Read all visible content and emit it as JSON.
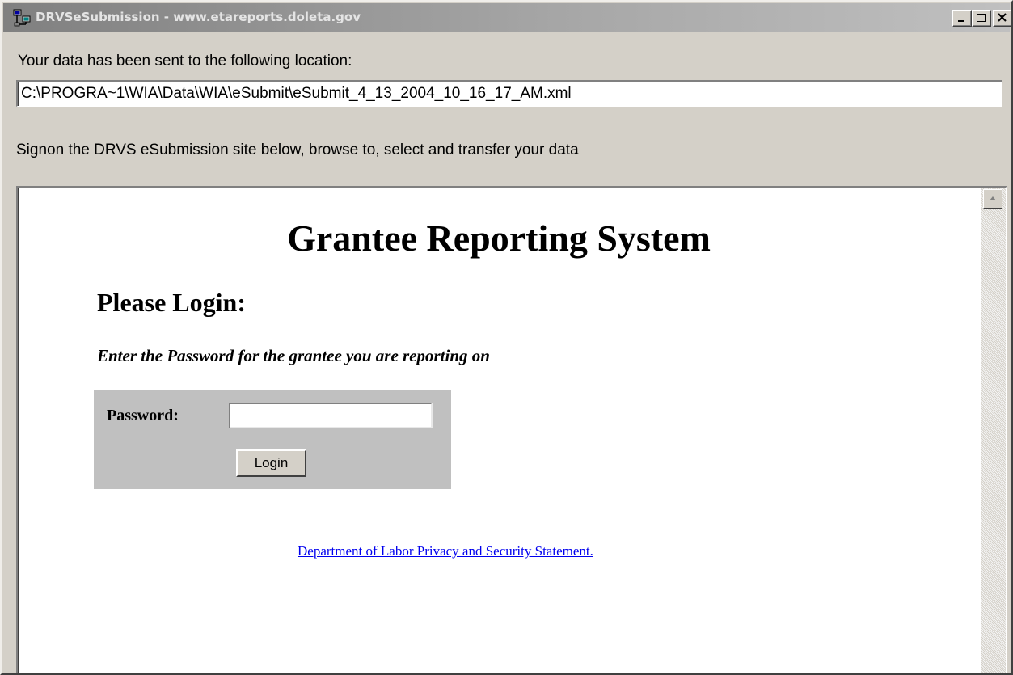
{
  "window": {
    "title": "DRVSeSubmission - www.etareports.doleta.gov",
    "app_icon": "network-computers-icon",
    "controls": {
      "minimize_icon": "minimize-icon",
      "maximize_icon": "maximize-icon",
      "close_icon": "close-icon"
    }
  },
  "header": {
    "sent_label": "Your data has been sent to the following location:",
    "file_path": "C:\\PROGRA~1\\WIA\\Data\\WIA\\eSubmit\\eSubmit_4_13_2004_10_16_17_AM.xml",
    "instruction": "Signon the DRVS eSubmission site below, browse to, select and transfer your data"
  },
  "browser": {
    "page_title": "Grantee Reporting System",
    "login_heading": "Please Login:",
    "login_instruction": "Enter the Password for the grantee you are reporting on",
    "password_label": "Password:",
    "password_value": "",
    "login_button": "Login",
    "privacy_link": "Department of Labor Privacy and Security Statement.",
    "scrollbar": {
      "up_icon": "scroll-up-arrow-icon"
    }
  },
  "colors": {
    "face": "#d4d0c8",
    "title_gradient_start": "#808080",
    "login_box": "#c0c0c0",
    "link": "#0000ee"
  }
}
